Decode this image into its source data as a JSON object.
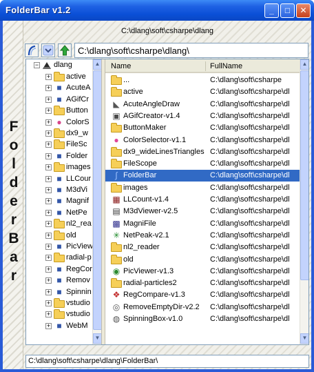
{
  "window": {
    "title": "FolderBar v1.2",
    "min_label": "_",
    "max_label": "□",
    "close_label": "✕"
  },
  "banner_letters": [
    "F",
    "o",
    "l",
    "d",
    "e",
    "r",
    "B",
    "a",
    "r"
  ],
  "path_label": "C:\\dlang\\soft\\csharpe\\dlang",
  "toolbar": {
    "path_value": "C:\\dlang\\soft\\csharpe\\dlang\\",
    "dropdown_glyph": "⌄",
    "up_glyph": "↑"
  },
  "tree": {
    "root": {
      "label": "dlang",
      "icon": "drive-icon"
    },
    "items": [
      {
        "label": "active",
        "icon": "folder-icon"
      },
      {
        "label": "AcuteA",
        "icon": "app-icon"
      },
      {
        "label": "AGifCr",
        "icon": "app-icon"
      },
      {
        "label": "Button",
        "icon": "folder-icon"
      },
      {
        "label": "ColorS",
        "icon": "color-icon"
      },
      {
        "label": "dx9_w",
        "icon": "folder-icon"
      },
      {
        "label": "FileSc",
        "icon": "folder-icon"
      },
      {
        "label": "Folder",
        "icon": "app-icon"
      },
      {
        "label": "images",
        "icon": "folder-icon"
      },
      {
        "label": "LLCour",
        "icon": "app-icon"
      },
      {
        "label": "M3dVi",
        "icon": "app-icon"
      },
      {
        "label": "Magnif",
        "icon": "app-icon"
      },
      {
        "label": "NetPe",
        "icon": "app-icon"
      },
      {
        "label": "nl2_rea",
        "icon": "folder-icon"
      },
      {
        "label": "old",
        "icon": "folder-icon"
      },
      {
        "label": "PicView",
        "icon": "app-icon"
      },
      {
        "label": "radial-p",
        "icon": "folder-icon"
      },
      {
        "label": "RegCor",
        "icon": "app-icon"
      },
      {
        "label": "Remov",
        "icon": "app-icon"
      },
      {
        "label": "Spinnin",
        "icon": "app-icon"
      },
      {
        "label": "vstudio",
        "icon": "folder-icon"
      },
      {
        "label": "vstudio",
        "icon": "folder-icon"
      },
      {
        "label": "WebM",
        "icon": "app-icon"
      }
    ]
  },
  "list": {
    "columns": {
      "name": "Name",
      "fullname": "FullName"
    },
    "rows": [
      {
        "name": "...",
        "full": "C:\\dlang\\soft\\csharpe",
        "icon": "folder-icon",
        "glyph": ""
      },
      {
        "name": "active",
        "full": "C:\\dlang\\soft\\csharpe\\dl",
        "icon": "folder-icon",
        "glyph": ""
      },
      {
        "name": "AcuteAngleDraw",
        "full": "C:\\dlang\\soft\\csharpe\\dl",
        "icon": "angle-icon",
        "glyph": "◣"
      },
      {
        "name": "AGifCreator-v1.4",
        "full": "C:\\dlang\\soft\\csharpe\\dl",
        "icon": "gif-icon",
        "glyph": "▣"
      },
      {
        "name": "ButtonMaker",
        "full": "C:\\dlang\\soft\\csharpe\\dl",
        "icon": "folder-icon",
        "glyph": ""
      },
      {
        "name": "ColorSelector-v1.1",
        "full": "C:\\dlang\\soft\\csharpe\\dl",
        "icon": "color-wheel-icon",
        "glyph": "●"
      },
      {
        "name": "dx9_wideLinesTriangles",
        "full": "C:\\dlang\\soft\\csharpe\\dl",
        "icon": "folder-icon",
        "glyph": ""
      },
      {
        "name": "FileScope",
        "full": "C:\\dlang\\soft\\csharpe\\dl",
        "icon": "folder-icon",
        "glyph": ""
      },
      {
        "name": "FolderBar",
        "full": "C:\\dlang\\soft\\csharpe\\dl",
        "icon": "folderbar-icon",
        "glyph": "∫"
      },
      {
        "name": "images",
        "full": "C:\\dlang\\soft\\csharpe\\dl",
        "icon": "folder-icon",
        "glyph": ""
      },
      {
        "name": "LLCount-v1.4",
        "full": "C:\\dlang\\soft\\csharpe\\dl",
        "icon": "llcount-icon",
        "glyph": "▦"
      },
      {
        "name": "M3dViewer-v2.5",
        "full": "C:\\dlang\\soft\\csharpe\\dl",
        "icon": "viewer-icon",
        "glyph": "▤"
      },
      {
        "name": "MagniFile",
        "full": "C:\\dlang\\soft\\csharpe\\dl",
        "icon": "magnify-icon",
        "glyph": "▩"
      },
      {
        "name": "NetPeak-v2.1",
        "full": "C:\\dlang\\soft\\csharpe\\dl",
        "icon": "netpeak-icon",
        "glyph": "✳"
      },
      {
        "name": "nl2_reader",
        "full": "C:\\dlang\\soft\\csharpe\\dl",
        "icon": "folder-icon",
        "glyph": ""
      },
      {
        "name": "old",
        "full": "C:\\dlang\\soft\\csharpe\\dl",
        "icon": "folder-icon",
        "glyph": ""
      },
      {
        "name": "PicViewer-v1.3",
        "full": "C:\\dlang\\soft\\csharpe\\dl",
        "icon": "picviewer-icon",
        "glyph": "◉"
      },
      {
        "name": "radial-particles2",
        "full": "C:\\dlang\\soft\\csharpe\\dl",
        "icon": "folder-icon",
        "glyph": ""
      },
      {
        "name": "RegCompare-v1.3",
        "full": "C:\\dlang\\soft\\csharpe\\dl",
        "icon": "regcompare-icon",
        "glyph": "❖"
      },
      {
        "name": "RemoveEmptyDir-v2.2",
        "full": "C:\\dlang\\soft\\csharpe\\dl",
        "icon": "remove-icon",
        "glyph": "◎"
      },
      {
        "name": "SpinningBox-v1.0",
        "full": "C:\\dlang\\soft\\csharpe\\dl",
        "icon": "spinning-icon",
        "glyph": "◍"
      }
    ],
    "selected_index": 8
  },
  "status_path": "C:\\dlang\\soft\\csharpe\\dlang\\FolderBar\\",
  "colors": {
    "title_bar": "#0a4fd6",
    "selection": "#316ac5",
    "folder": "#f6cf58"
  }
}
